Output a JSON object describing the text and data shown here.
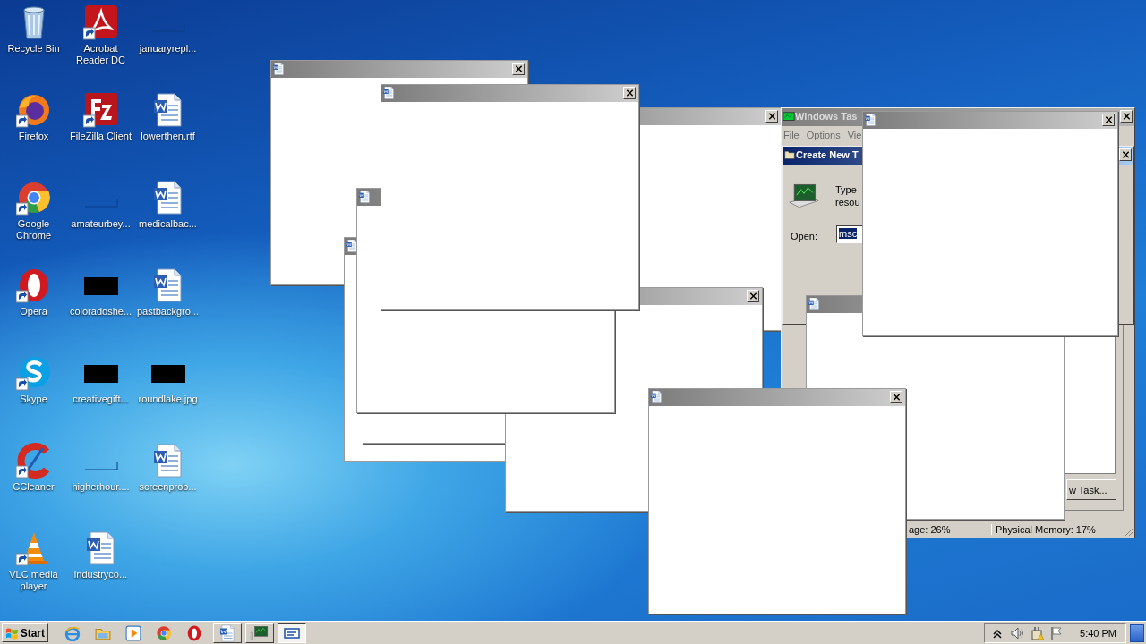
{
  "desktop_icon_columns": [
    [
      {
        "label": "Recycle Bin",
        "kind": "recycle",
        "shortcut": false
      },
      {
        "label": "Firefox",
        "kind": "firefox",
        "shortcut": true
      },
      {
        "label": "Google Chrome",
        "kind": "chrome",
        "shortcut": true
      },
      {
        "label": "Opera",
        "kind": "opera",
        "shortcut": true
      },
      {
        "label": "Skype",
        "kind": "skype",
        "shortcut": true
      },
      {
        "label": "CCleaner",
        "kind": "ccleaner",
        "shortcut": true
      },
      {
        "label": "VLC media player",
        "kind": "vlc",
        "shortcut": true
      }
    ],
    [
      {
        "label": "Acrobat Reader DC",
        "kind": "acrobat",
        "shortcut": true
      },
      {
        "label": "FileZilla Client",
        "kind": "filezilla",
        "shortcut": true
      },
      {
        "label": "amateurbey...",
        "kind": "blank",
        "shortcut": false
      },
      {
        "label": "coloradoshe...",
        "kind": "black",
        "shortcut": false
      },
      {
        "label": "creativegift...",
        "kind": "black",
        "shortcut": false
      },
      {
        "label": "higherhour....",
        "kind": "blank",
        "shortcut": false
      },
      {
        "label": "industryco...",
        "kind": "word",
        "shortcut": false
      }
    ],
    [
      {
        "label": "januaryrepl...",
        "kind": "blank",
        "shortcut": false
      },
      {
        "label": "lowerthen.rtf",
        "kind": "word",
        "shortcut": false
      },
      {
        "label": "medicalbac...",
        "kind": "word",
        "shortcut": false
      },
      {
        "label": "pastbackgro...",
        "kind": "word",
        "shortcut": false
      },
      {
        "label": "roundlake.jpg",
        "kind": "black",
        "shortcut": false
      },
      {
        "label": "screenprob...",
        "kind": "word",
        "shortcut": false
      }
    ]
  ],
  "windows": [
    {
      "kind": "blank",
      "parts": [
        {
          "kind": "title_icon"
        },
        {
          "kind": "close_button"
        }
      ]
    },
    {
      "kind": "blank",
      "parts": [
        {
          "kind": "title_icon"
        }
      ]
    },
    {
      "kind": "blank"
    },
    {
      "kind": "blank",
      "parts": [
        {
          "kind": "close_button"
        }
      ]
    },
    {
      "kind": "blank",
      "parts": [
        {
          "kind": "close_button"
        }
      ]
    },
    {
      "kind": "blank",
      "parts": [
        {
          "kind": "title_icon"
        }
      ]
    },
    {
      "kind": "blank",
      "parts": [
        {
          "kind": "title_icon"
        },
        {
          "kind": "close_button"
        }
      ]
    },
    {
      "kind": "task_manager",
      "title": "Windows Tas",
      "menu": [
        "File",
        "Options",
        "Vie"
      ],
      "dialog": {
        "title": "Create New T",
        "prompt_lines": [
          "Type",
          "resou"
        ],
        "open_label": "Open:",
        "open_value": "msc"
      },
      "new_task_button": "w Task...",
      "status": [
        "age: 26%",
        "Physical Memory: 17%"
      ]
    },
    {
      "kind": "blank",
      "parts": [
        {
          "kind": "title_icon"
        }
      ]
    },
    {
      "kind": "blank",
      "parts": [
        {
          "kind": "title_icon"
        },
        {
          "kind": "close_button"
        }
      ]
    },
    {
      "kind": "blank",
      "parts": [
        {
          "kind": "title_icon"
        },
        {
          "kind": "close_button"
        }
      ]
    }
  ],
  "taskbar": {
    "start": "Start",
    "quick_launch": [
      {
        "kind": "ie"
      },
      {
        "kind": "folder"
      },
      {
        "kind": "media"
      },
      {
        "kind": "chrome"
      },
      {
        "kind": "opera"
      }
    ],
    "tasks": [
      {
        "kind": "word",
        "selected": false
      },
      {
        "kind": "taskmgr",
        "selected": false
      },
      {
        "kind": "dialog",
        "selected": true
      }
    ],
    "tray": [
      {
        "kind": "arrow"
      },
      {
        "kind": "speaker"
      },
      {
        "kind": "network"
      },
      {
        "kind": "flag"
      }
    ],
    "clock": "5:40 PM"
  }
}
